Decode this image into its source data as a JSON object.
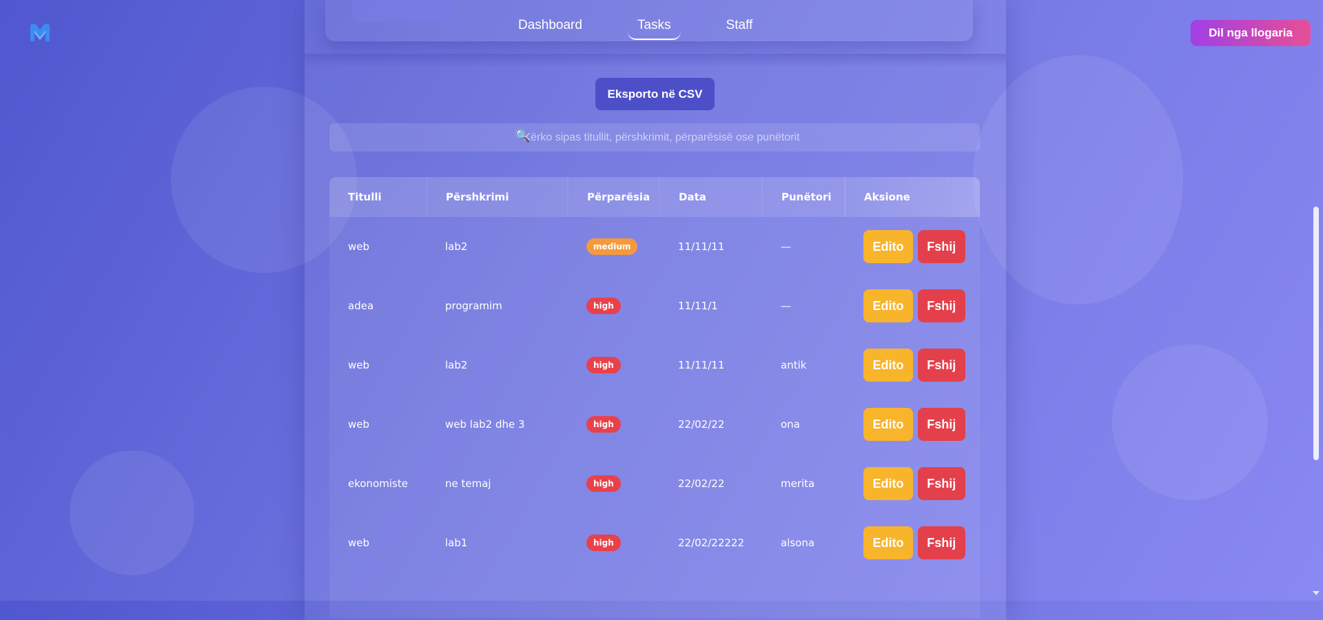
{
  "nav": {
    "items": [
      {
        "label": "Dashboard",
        "active": false
      },
      {
        "label": "Tasks",
        "active": true
      },
      {
        "label": "Staff",
        "active": false
      }
    ],
    "logout_label": "Dil nga llogaria"
  },
  "toolbar": {
    "export_label": "Eksporto në CSV",
    "search_icon": "🔍",
    "search_placeholder": "Kërko sipas titullit, përshkrimit, përparësisë ose punëtorit"
  },
  "table": {
    "headers": [
      "Titulli",
      "Përshkrimi",
      "Përparësia",
      "Data",
      "Punëtori",
      "Aksione"
    ],
    "edit_label": "Edito",
    "delete_label": "Fshij",
    "rows": [
      {
        "title": "web",
        "description": "lab2",
        "priority": "medium",
        "date": "11/11/11",
        "worker": "—"
      },
      {
        "title": "adea",
        "description": "programim",
        "priority": "high",
        "date": "11/11/1",
        "worker": "—"
      },
      {
        "title": "web",
        "description": "lab2",
        "priority": "high",
        "date": "11/11/11",
        "worker": "antik"
      },
      {
        "title": "web",
        "description": "web lab2 dhe 3",
        "priority": "high",
        "date": "22/02/22",
        "worker": "ona"
      },
      {
        "title": "ekonomiste",
        "description": "ne temaj",
        "priority": "high",
        "date": "22/02/22",
        "worker": "merita"
      },
      {
        "title": "web",
        "description": "lab1",
        "priority": "high",
        "date": "22/02/22222",
        "worker": "alsona"
      }
    ]
  },
  "colors": {
    "accent": "#4d4fc9",
    "medium": "#f59a3c",
    "high": "#e8414a",
    "edit": "#f8b42b",
    "delete": "#e4404c"
  }
}
